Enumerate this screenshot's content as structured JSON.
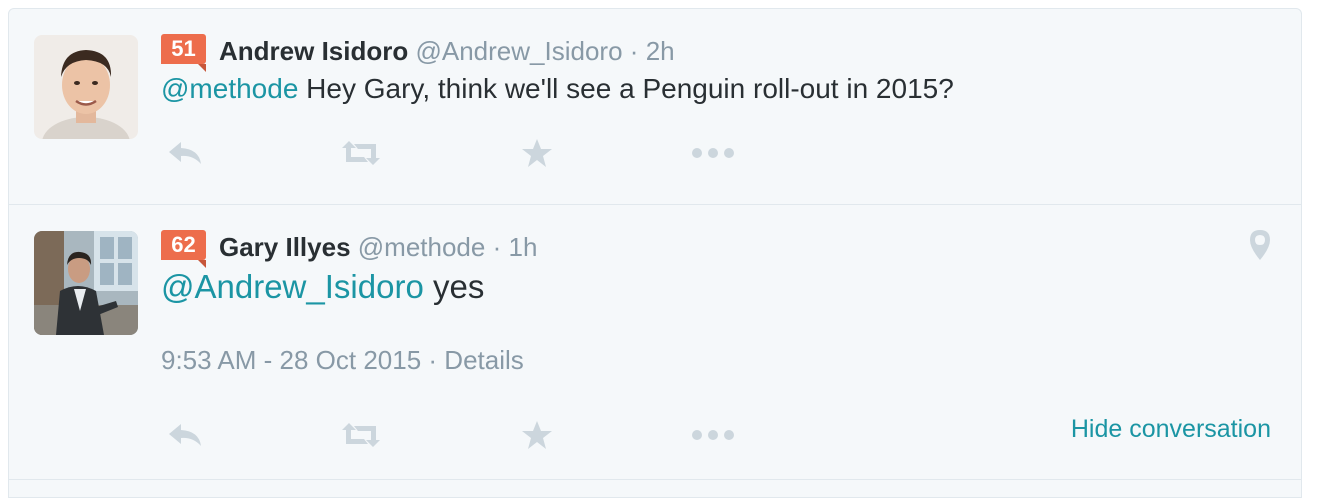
{
  "tweets": [
    {
      "rank": "51",
      "name": "Andrew Isidoro",
      "handle": "@Andrew_Isidoro",
      "separator": "·",
      "time": "2h",
      "mention": "@methode",
      "body": " Hey Gary, think we'll see a Penguin roll-out in 2015?"
    },
    {
      "rank": "62",
      "name": "Gary Illyes",
      "handle": "@methode",
      "separator": "·",
      "time": "1h",
      "mention": "@Andrew_Isidoro",
      "body": " yes",
      "timestamp": "9:53 AM - 28 Oct 2015",
      "details": "Details",
      "hide_conversation": "Hide conversation"
    }
  ],
  "colors": {
    "accent": "#1b95a4",
    "badge": "#ed6d4c",
    "muted": "#8899a6",
    "icon": "#ccd6dd",
    "background": "#f5f8fa"
  },
  "icons": [
    "reply-icon",
    "retweet-icon",
    "favorite-icon",
    "more-icon",
    "location-pin-icon"
  ]
}
